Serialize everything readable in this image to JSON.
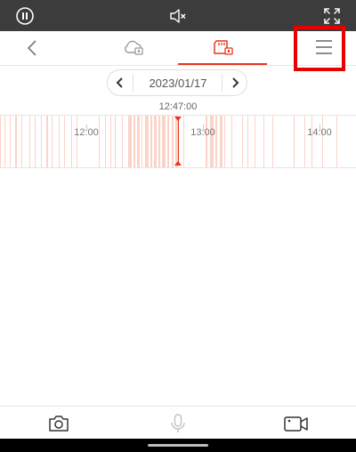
{
  "top_bar": {
    "icons": [
      "pause-circle-icon",
      "mute-icon",
      "fullscreen-icon"
    ]
  },
  "nav_bar": {
    "icons": [
      "back-arrow-icon",
      "cloud-playback-icon",
      "sd-card-playback-icon",
      "menu-icon"
    ],
    "active_tab": "sd-card-playback",
    "highlight_color": "#e60000"
  },
  "date_selector": {
    "date": "2023/01/17",
    "prev_icon": "chevron-left-icon",
    "next_icon": "chevron-right-icon"
  },
  "timeline": {
    "current_time": "12:47:00",
    "hour_labels": [
      "12:00",
      "13:00",
      "14:00"
    ],
    "recording_color": "#fbd3c8",
    "cursor_color": "#e8341c"
  },
  "bottom_bar": {
    "icons": [
      "camera-snapshot-icon",
      "microphone-icon",
      "video-record-icon"
    ]
  },
  "colors": {
    "accent": "#e8341c",
    "topbar_bg": "#3c3c3c"
  }
}
